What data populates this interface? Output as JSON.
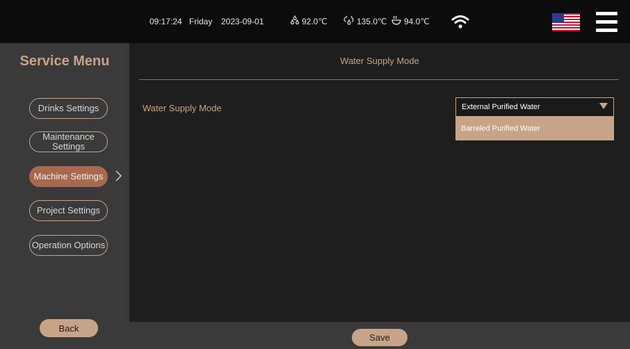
{
  "status": {
    "time": "09:17:24",
    "day": "Friday",
    "date": "2023-09-01",
    "temp_1": "92.0℃",
    "temp_2": "135.0℃",
    "temp_3": "94.0℃"
  },
  "sidebar": {
    "title": "Service Menu",
    "items": [
      {
        "label": "Drinks Settings",
        "active": false
      },
      {
        "label": "Maintenance Settings",
        "active": false
      },
      {
        "label": "Machine Settings",
        "active": true
      },
      {
        "label": "Project Settings",
        "active": false
      },
      {
        "label": "Operation Options",
        "active": false
      }
    ],
    "back_label": "Back"
  },
  "main": {
    "title": "Water Supply Mode",
    "field_label": "Water Supply Mode",
    "select_value": "External Purified Water",
    "dropdown_options": [
      "Barreled Purified Water"
    ]
  },
  "footer": {
    "save_label": "Save"
  },
  "icons": {
    "temp_1": "drops-icon",
    "temp_2": "cloud-drop-icon",
    "temp_3": "steam-cup-icon",
    "wifi": "wifi-icon",
    "flag": "us-flag-icon",
    "menu": "hamburger-menu-icon",
    "nav_arrow": "chevron-right-icon",
    "dropdown": "caret-down-icon"
  },
  "colors": {
    "accent": "#c7a388",
    "active": "#a8694f",
    "sidebar_bg": "#3a3a3a",
    "topbar_bg": "#0c0c0c",
    "main_bg": "#1e1e1e"
  }
}
